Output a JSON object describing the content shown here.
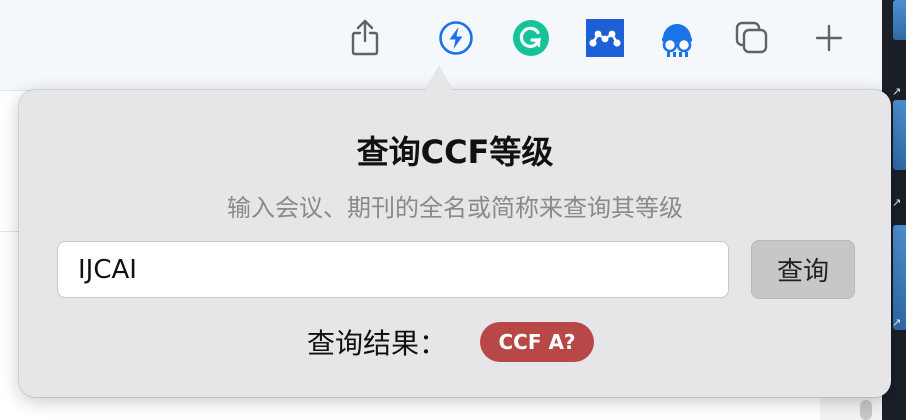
{
  "toolbar": {
    "icons": [
      "share-icon",
      "lightning-icon",
      "grammarly-icon",
      "mendeley-icon",
      "ghost-robot-icon",
      "tabs-overview-icon",
      "new-tab-plus-icon"
    ],
    "accent": "#1a73e8",
    "grammarly_color": "#15c39a",
    "mendeley_color": "#1c5fd6"
  },
  "popover": {
    "title": "查询CCF等级",
    "subtitle": "输入会议、期刊的全名或简称来查询其等级",
    "input_value": "IJCAI",
    "query_button": "查询",
    "result_label": "查询结果：",
    "result_badge": "CCF A?",
    "badge_color": "#b84848"
  },
  "edge_arrows": [
    "↗",
    "↗",
    "↗"
  ]
}
